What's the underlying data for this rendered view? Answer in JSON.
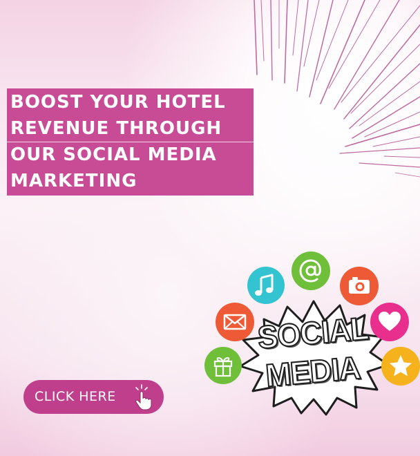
{
  "headline": {
    "lines": [
      "BOOST YOUR HOTEL",
      "REVENUE THROUGH",
      "OUR SOCIAL MEDIA",
      "MARKETING"
    ]
  },
  "cta": {
    "label": "CLICK HERE",
    "icon": "pointing-hand-icon"
  },
  "illustration": {
    "burst_lines": [
      "SOCIAL",
      "MEDIA"
    ],
    "icons": [
      {
        "name": "music-note-icon",
        "color": "#33c3d1"
      },
      {
        "name": "at-sign-icon",
        "color": "#6fbf3a"
      },
      {
        "name": "camera-icon",
        "color": "#ef5a36"
      },
      {
        "name": "envelope-icon",
        "color": "#ef5a36"
      },
      {
        "name": "heart-icon",
        "color": "#e82f8d"
      },
      {
        "name": "gift-icon",
        "color": "#6fbf3a"
      },
      {
        "name": "star-icon",
        "color": "#f5b21c"
      }
    ]
  },
  "colors": {
    "brand_pink": "#c84b95",
    "button_pink": "#c03f8c",
    "ray_color": "#c06aa0"
  }
}
